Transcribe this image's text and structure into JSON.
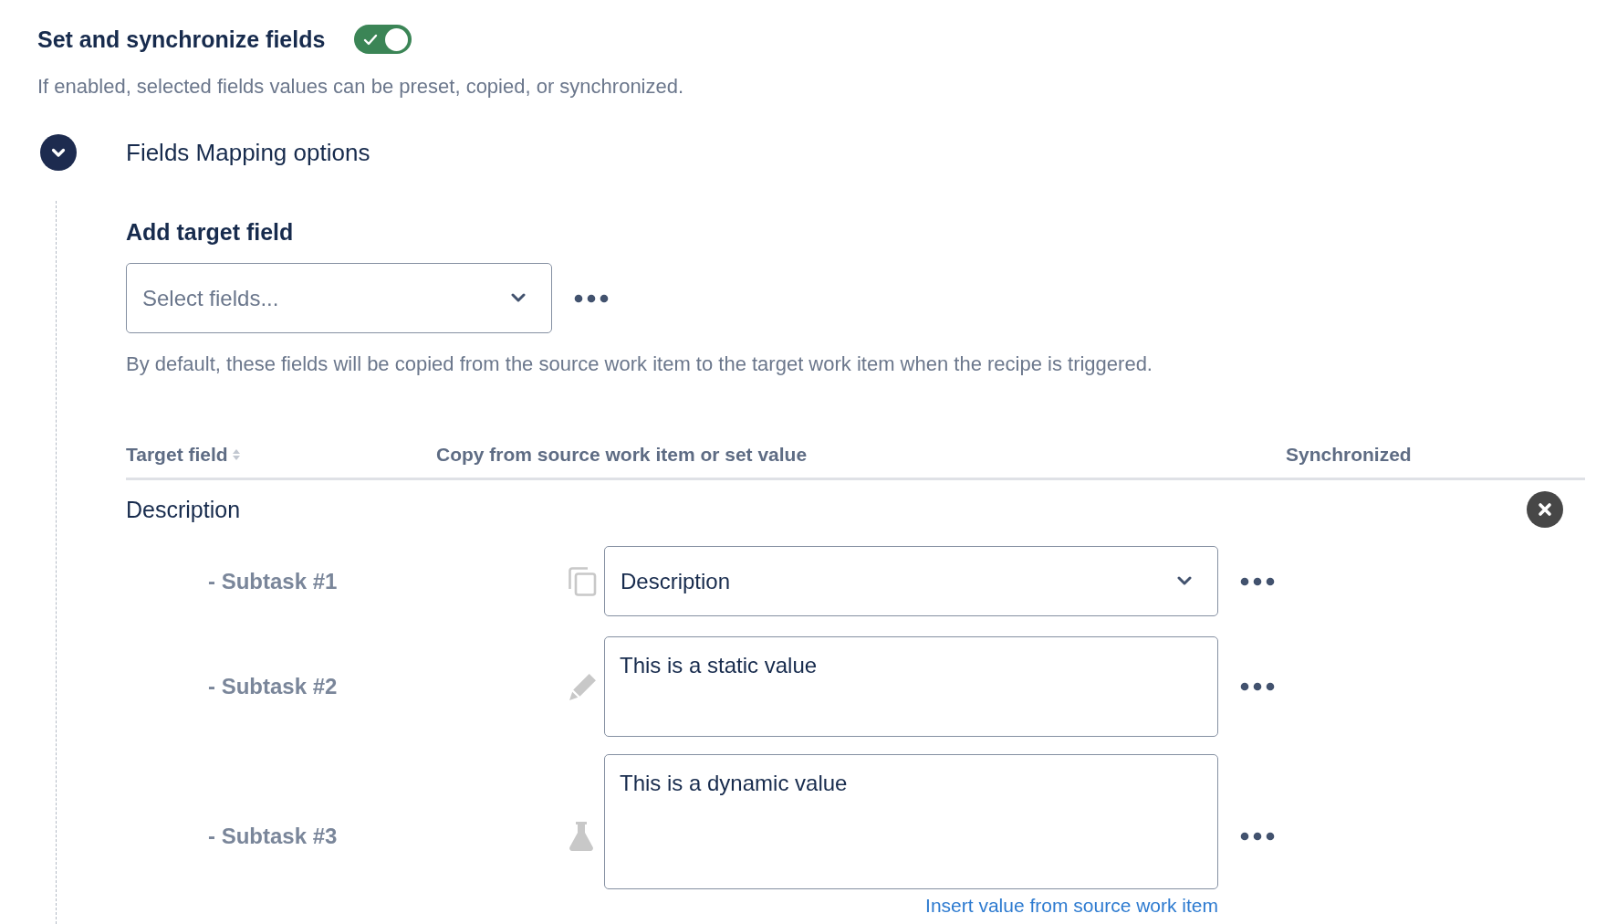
{
  "section": {
    "title": "Set and synchronize fields",
    "toggle": {
      "on": true
    },
    "description": "If enabled, selected fields values can be preset, copied, or synchronized."
  },
  "mapping": {
    "title": "Fields Mapping options",
    "expanded": true,
    "add_target_field": {
      "label": "Add target field",
      "select": {
        "placeholder": "Select fields..."
      },
      "help": "By default, these fields will be copied from the source work item to the target work item when the recipe is triggered."
    },
    "table": {
      "columns": [
        "Target field",
        "Copy from source work item or set value",
        "Synchronized"
      ],
      "groups": [
        {
          "name": "Description",
          "rows": [
            {
              "label": "- Subtask #1",
              "kind": "copy",
              "value": "Description"
            },
            {
              "label": "- Subtask #2",
              "kind": "static",
              "value": "This is a static value"
            },
            {
              "label": "- Subtask #3",
              "kind": "dynamic",
              "value": "This is a dynamic value",
              "link": "Insert value from source work item"
            }
          ]
        }
      ]
    }
  }
}
